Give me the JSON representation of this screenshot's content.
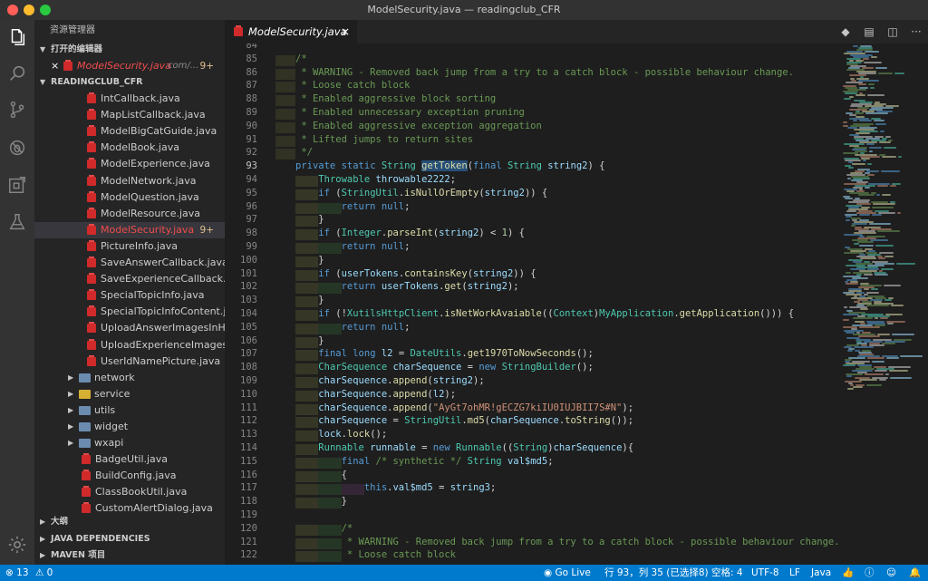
{
  "window": {
    "title": "ModelSecurity.java — readingclub_CFR"
  },
  "sidebar": {
    "title": "资源管理器",
    "open_editors": {
      "label": "打开的编辑器",
      "file": "ModelSecurity.java",
      "path": "com/...",
      "badge": "9+"
    },
    "project": {
      "label": "READINGCLUB_CFR"
    },
    "items": [
      {
        "type": "java",
        "label": "IntCallback.java"
      },
      {
        "type": "java",
        "label": "MapListCallback.java"
      },
      {
        "type": "java",
        "label": "ModelBigCatGuide.java"
      },
      {
        "type": "java",
        "label": "ModelBook.java"
      },
      {
        "type": "java",
        "label": "ModelExperience.java"
      },
      {
        "type": "java",
        "label": "ModelNetwork.java"
      },
      {
        "type": "java",
        "label": "ModelQuestion.java"
      },
      {
        "type": "java",
        "label": "ModelResource.java"
      },
      {
        "type": "java",
        "label": "ModelSecurity.java",
        "badge": "9+",
        "selected": true
      },
      {
        "type": "java",
        "label": "PictureInfo.java"
      },
      {
        "type": "java",
        "label": "SaveAnswerCallback.java"
      },
      {
        "type": "java",
        "label": "SaveExperienceCallback.j..."
      },
      {
        "type": "java",
        "label": "SpecialTopicInfo.java"
      },
      {
        "type": "java",
        "label": "SpecialTopicInfoContent.j..."
      },
      {
        "type": "java",
        "label": "UploadAnswerImagesInH..."
      },
      {
        "type": "java",
        "label": "UploadExperienceImages..."
      },
      {
        "type": "java",
        "label": "UserIdNamePicture.java"
      },
      {
        "type": "folder",
        "label": "network"
      },
      {
        "type": "folder",
        "label": "service",
        "special": true
      },
      {
        "type": "folder",
        "label": "utils"
      },
      {
        "type": "folder",
        "label": "widget"
      },
      {
        "type": "folder",
        "label": "wxapi"
      },
      {
        "type": "java2",
        "label": "BadgeUtil.java"
      },
      {
        "type": "java2",
        "label": "BuildConfig.java"
      },
      {
        "type": "java2",
        "label": "ClassBookUtil.java"
      },
      {
        "type": "java2",
        "label": "CustomAlertDialog.java"
      }
    ],
    "outline": "大纲",
    "java_deps": "JAVA DEPENDENCIES",
    "maven": "MAVEN 项目"
  },
  "tab": {
    "label": "ModelSecurity.java",
    "close": "×"
  },
  "tab_actions": [
    "◆",
    "▤",
    "◫",
    "···"
  ],
  "editor": {
    "lines": [
      {
        "n": "84",
        "t": ""
      },
      {
        "n": "85",
        "t": "/*"
      },
      {
        "n": "86",
        "t": " * WARNING - Removed back jump from a try to a catch block - possible behaviour change."
      },
      {
        "n": "87",
        "t": " * Loose catch block"
      },
      {
        "n": "88",
        "t": " * Enabled aggressive block sorting"
      },
      {
        "n": "89",
        "t": " * Enabled unnecessary exception pruning"
      },
      {
        "n": "90",
        "t": " * Enabled aggressive exception aggregation"
      },
      {
        "n": "91",
        "t": " * Lifted jumps to return sites"
      },
      {
        "n": "92",
        "t": " */"
      },
      {
        "n": "93",
        "t": "private static String getToken(final String string2) {"
      },
      {
        "n": "94",
        "t": "    Throwable throwable2222;"
      },
      {
        "n": "95",
        "t": "    if (StringUtil.isNullOrEmpty(string2)) {"
      },
      {
        "n": "96",
        "t": "        return null;"
      },
      {
        "n": "97",
        "t": "    }"
      },
      {
        "n": "98",
        "t": "    if (Integer.parseInt(string2) < 1) {"
      },
      {
        "n": "99",
        "t": "        return null;"
      },
      {
        "n": "100",
        "t": "    }"
      },
      {
        "n": "101",
        "t": "    if (userTokens.containsKey(string2)) {"
      },
      {
        "n": "102",
        "t": "        return userTokens.get(string2);"
      },
      {
        "n": "103",
        "t": "    }"
      },
      {
        "n": "104",
        "t": "    if (!XutilsHttpClient.isNetWorkAvaiable((Context)MyApplication.getApplication())) {"
      },
      {
        "n": "105",
        "t": "        return null;"
      },
      {
        "n": "106",
        "t": "    }"
      },
      {
        "n": "107",
        "t": "    final long l2 = DateUtils.get1970ToNowSeconds();"
      },
      {
        "n": "108",
        "t": "    CharSequence charSequence = new StringBuilder();"
      },
      {
        "n": "109",
        "t": "    charSequence.append(string2);"
      },
      {
        "n": "110",
        "t": "    charSequence.append(l2);"
      },
      {
        "n": "111",
        "t": "    charSequence.append(\"AyGt7ohMR!gECZG7kiIU0IUJBII7S#N\");"
      },
      {
        "n": "112",
        "t": "    charSequence = StringUtil.md5(charSequence.toString());"
      },
      {
        "n": "113",
        "t": "    lock.lock();"
      },
      {
        "n": "114",
        "t": "    Runnable runnable = new Runnable((String)charSequence){"
      },
      {
        "n": "115",
        "t": "        final /* synthetic */ String val$md5;"
      },
      {
        "n": "116",
        "t": "        {"
      },
      {
        "n": "117",
        "t": "            this.val$md5 = string3;"
      },
      {
        "n": "118",
        "t": "        }"
      },
      {
        "n": "119",
        "t": ""
      },
      {
        "n": "120",
        "t": "        /*"
      },
      {
        "n": "121",
        "t": "         * WARNING - Removed back jump from a try to a catch block - possible behaviour change."
      },
      {
        "n": "122",
        "t": "         * Loose catch block"
      }
    ]
  },
  "status": {
    "errors": "13",
    "warnings": "0",
    "go_live": "Go Live",
    "position": "行 93，列 35 (已选择8)",
    "spaces": "空格: 4",
    "encoding": "UTF-8",
    "eol": "LF",
    "language": "Java"
  },
  "colors": {
    "status_bar": "#007acc",
    "java_icon": "#d02a2a",
    "badge": "#e2c08d"
  }
}
